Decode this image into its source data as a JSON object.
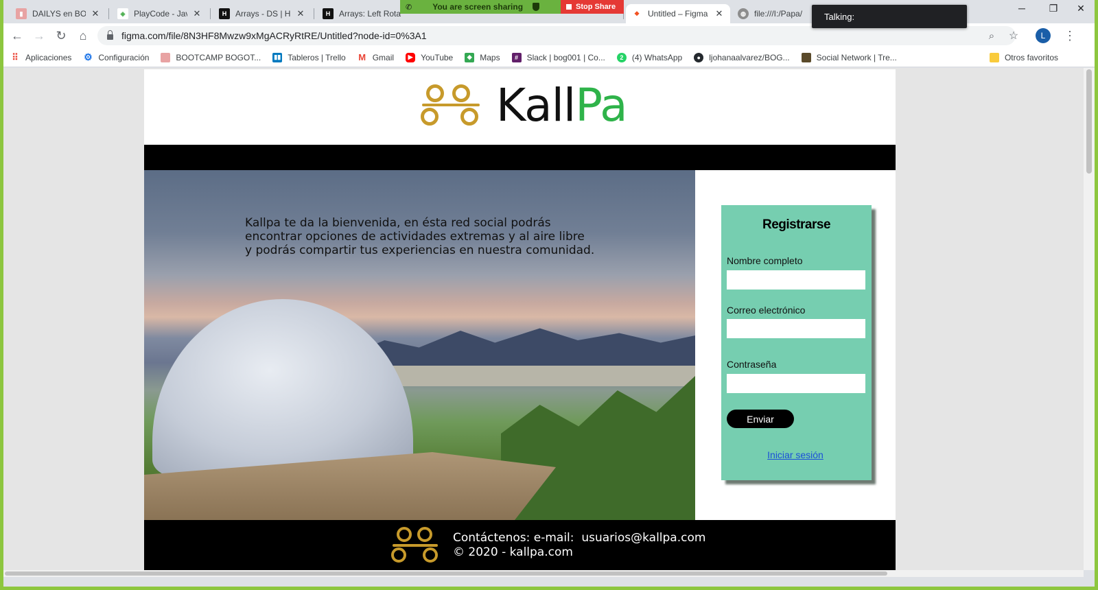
{
  "browser": {
    "tabs": [
      {
        "title": "DAILYS en BOOTC",
        "favicon": "trello-icon",
        "color": "#e8a3a3"
      },
      {
        "title": "PlayCode - Javas",
        "favicon": "playcode-icon",
        "color": "#4caf50"
      },
      {
        "title": "Arrays - DS | Hac",
        "favicon": "hackerrank-icon",
        "color": "#111111"
      },
      {
        "title": "Arrays: Left Rota",
        "favicon": "hackerrank-icon",
        "color": "#111111"
      },
      {
        "title": "Untitled – Figma",
        "favicon": "figma-icon",
        "color": "#f24e1e"
      },
      {
        "title": "file:///I:/Papa/",
        "favicon": "globe-icon",
        "color": "#8d8d8d"
      }
    ],
    "share_banner": "You are screen sharing",
    "stop_share": "Stop Share",
    "talking": "Talking:",
    "url": "figma.com/file/8N3HF8Mwzw9xMgACRyRtRE/Untitled?node-id=0%3A1",
    "avatar_letter": "L",
    "bookmarks": [
      {
        "label": "Aplicaciones",
        "icon": "apps-grid-icon",
        "color": "#ea4335"
      },
      {
        "label": "Configuración",
        "icon": "gear-icon",
        "color": "#1a73e8"
      },
      {
        "label": "BOOTCAMP BOGOT...",
        "icon": "bootcamp-icon",
        "color": "#e8a3a3"
      },
      {
        "label": "Tableros | Trello",
        "icon": "trello-icon",
        "color": "#0079bf"
      },
      {
        "label": "Gmail",
        "icon": "gmail-icon",
        "color": "#ea4335"
      },
      {
        "label": "YouTube",
        "icon": "youtube-icon",
        "color": "#ff0000"
      },
      {
        "label": "Maps",
        "icon": "maps-icon",
        "color": "#34a853"
      },
      {
        "label": "Slack | bog001 | Co...",
        "icon": "slack-icon",
        "color": "#611f69"
      },
      {
        "label": "(4) WhatsApp",
        "icon": "whatsapp-icon",
        "color": "#25d366"
      },
      {
        "label": "ljohanaalvarez/BOG...",
        "icon": "github-icon",
        "color": "#24292e"
      },
      {
        "label": "Social Network | Tre...",
        "icon": "trello-icon",
        "color": "#5a4a2a"
      }
    ],
    "other_bookmarks": "Otros favoritos"
  },
  "site": {
    "brand_dark": "Kall",
    "brand_green": "Pa",
    "brand_colors": {
      "dark": "#111111",
      "green": "#2fb34a",
      "gold": "#c79a2b"
    },
    "hero_text": "Kallpa te da la bienvenida, en ésta red social podrás encontrar opciones de actividades extremas y al aire libre y podrás compartir tus experiencias en nuestra comunidad.",
    "signup": {
      "title": "Registrarse",
      "name_label": "Nombre completo",
      "email_label": "Correo electrónico",
      "password_label": "Contraseña",
      "submit": "Enviar",
      "login_link": "Iniciar sesión",
      "card_color": "#76ceb0"
    },
    "footer": {
      "contact": "Contáctenos: e-mail:  usuarios@kallpa.com",
      "copyright": "© 2020 - kallpa.com"
    }
  }
}
